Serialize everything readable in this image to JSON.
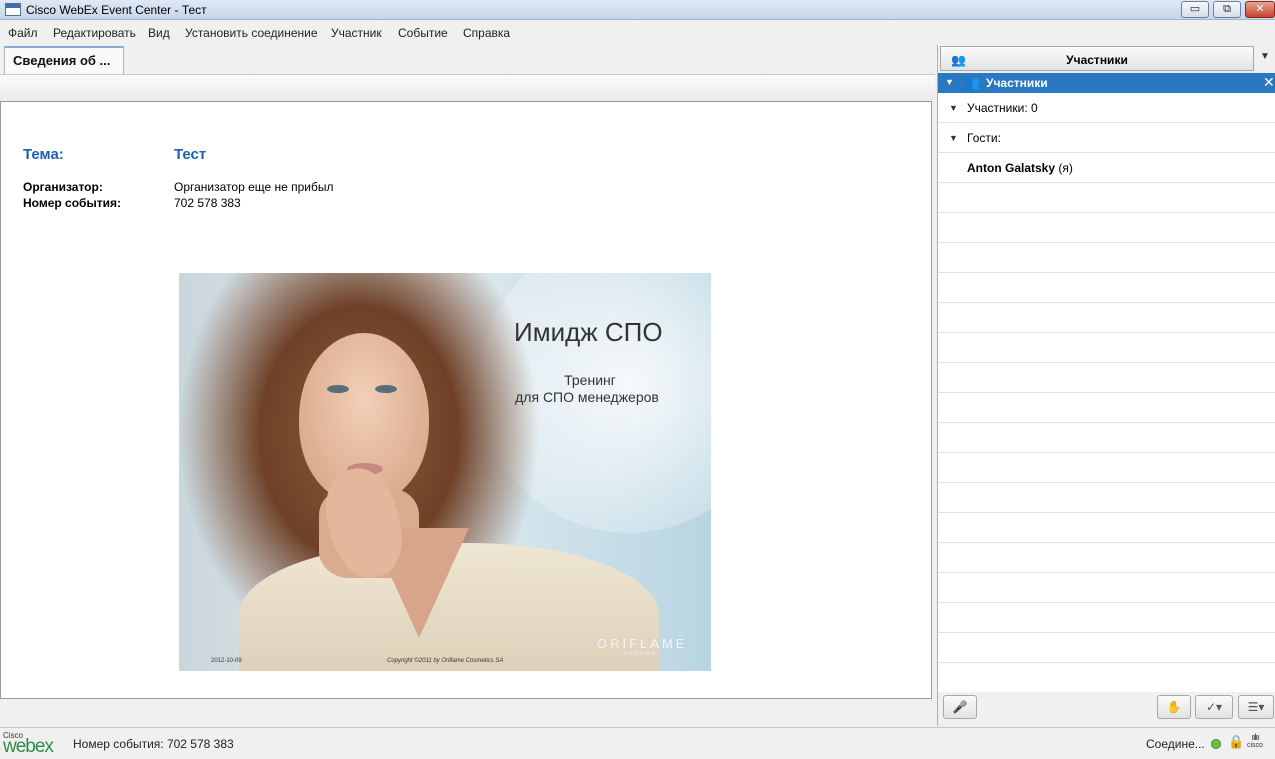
{
  "window": {
    "title": "Cisco WebEx Event Center - Тест",
    "controls": {
      "minimize": "▭",
      "maximize": "⧉",
      "close": "✕"
    }
  },
  "menu": [
    "Файл",
    "Редактировать",
    "Вид",
    "Установить соединение",
    "Участник",
    "Событие",
    "Справка"
  ],
  "tab": {
    "label": "Сведения об ..."
  },
  "info": {
    "topic_label": "Тема:",
    "topic_value": "Тест",
    "organizer_label": "Организатор:",
    "organizer_value": "Организатор еще не прибыл",
    "event_number_label": "Номер события:",
    "event_number_value": "702 578 383"
  },
  "slide": {
    "title": "Имидж СПО",
    "subtitle_line1": "Тренинг",
    "subtitle_line2": "для СПО менеджеров",
    "logo": "ORIFLAME",
    "logo_sub": "SWEDEN",
    "copyright": "Copyright ©2011 by Oriflame Cosmetics SA",
    "date": "2012-10-09"
  },
  "participants_panel": {
    "header": "Участники",
    "section_title": "Участники",
    "participants_count_label": "Участники: 0",
    "guests_label": "Гости:",
    "guest_name": "Anton Galatsky",
    "guest_me": " (я)"
  },
  "status_bar": {
    "logo_cisco": "Cisco",
    "logo_webex": "webex",
    "event_number": "Номер события: 702 578 383",
    "connection": "Соедине...",
    "cisco_mark": "cisco"
  },
  "icons": {
    "participants": "👥",
    "dropdown": "▼",
    "close": "✕",
    "collapse": "▼",
    "mic": "🎤",
    "hand": "✋",
    "feedback": "✓▾",
    "list": "☰▾",
    "lock": "🔒"
  },
  "colors": {
    "accent_blue": "#2b78c2",
    "topic_blue": "#1f5fb4",
    "webex_green": "#2f8e45",
    "status_green": "#6cbf3c"
  }
}
